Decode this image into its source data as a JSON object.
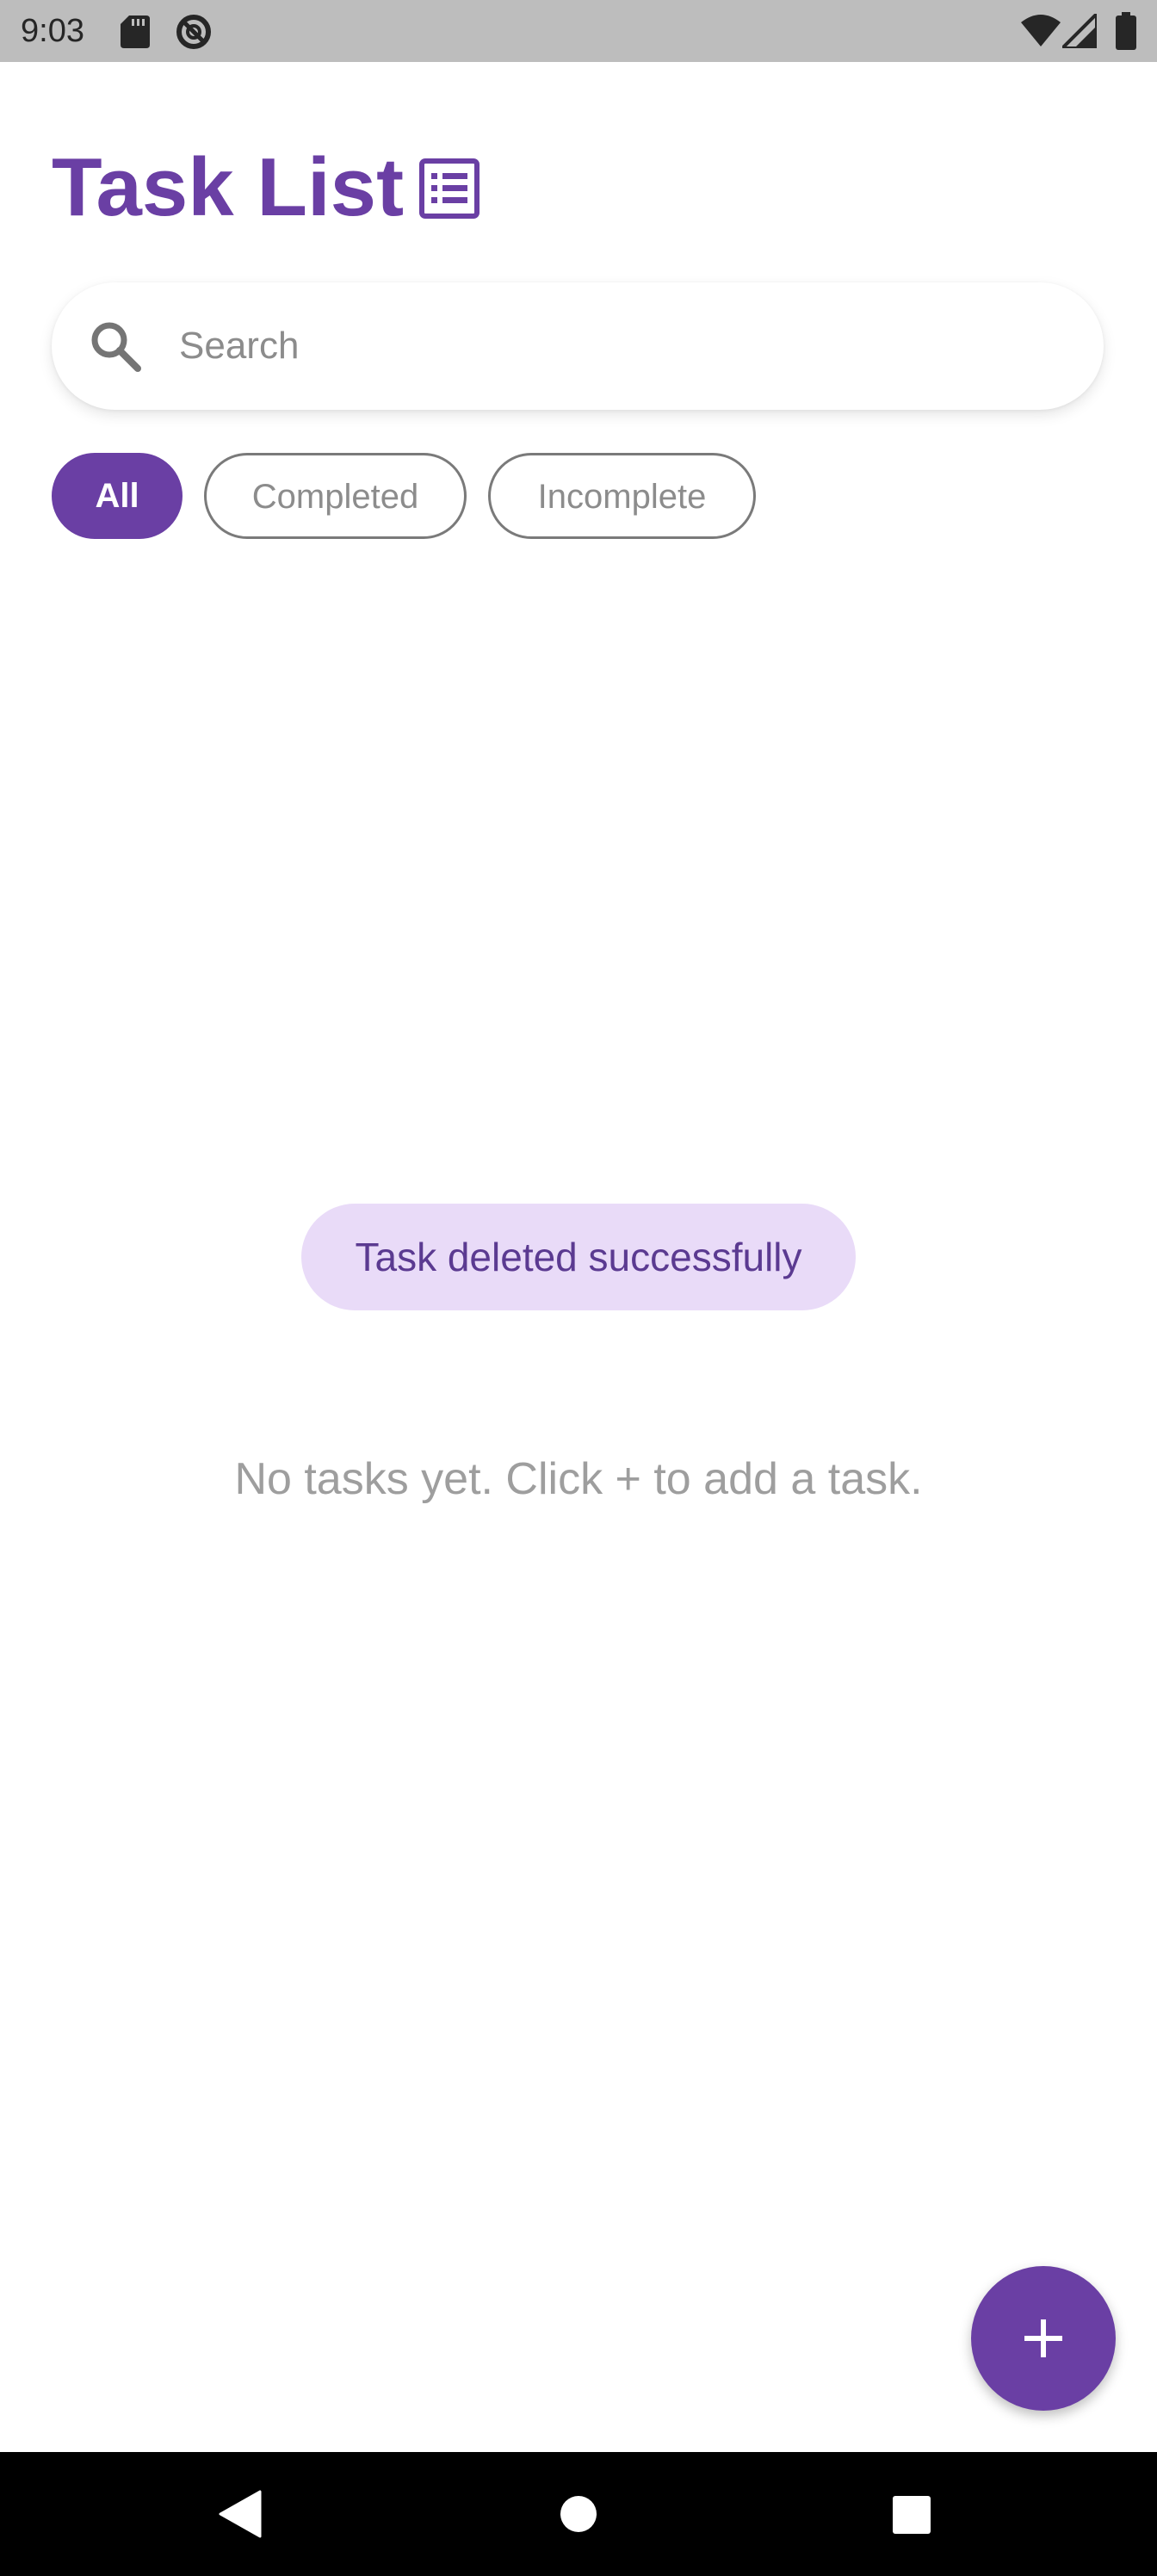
{
  "status_bar": {
    "time": "9:03",
    "icons": [
      "sd-card-icon",
      "do-not-disturb-icon",
      "wifi-icon",
      "signal-icon",
      "battery-icon"
    ]
  },
  "header": {
    "title": "Task List",
    "icon": "list-icon"
  },
  "search": {
    "placeholder": "Search",
    "value": "",
    "icon": "search-icon"
  },
  "filters": {
    "chips": [
      {
        "label": "All",
        "selected": true
      },
      {
        "label": "Completed",
        "selected": false
      },
      {
        "label": "Incomplete",
        "selected": false
      }
    ]
  },
  "toast": {
    "message": "Task deleted successfully"
  },
  "empty_state": {
    "message": "No tasks yet. Click + to add a task."
  },
  "fab": {
    "icon": "plus-icon"
  },
  "nav_bar": {
    "buttons": [
      "back-icon",
      "home-icon",
      "recents-icon"
    ]
  },
  "colors": {
    "accent": "#6a3fa4",
    "toast_background": "#e9dbf8",
    "toast_text": "#5b3a91",
    "status_bar": "#bdbdbd",
    "nav_bar": "#000000",
    "muted_text": "#9e9e9e"
  }
}
